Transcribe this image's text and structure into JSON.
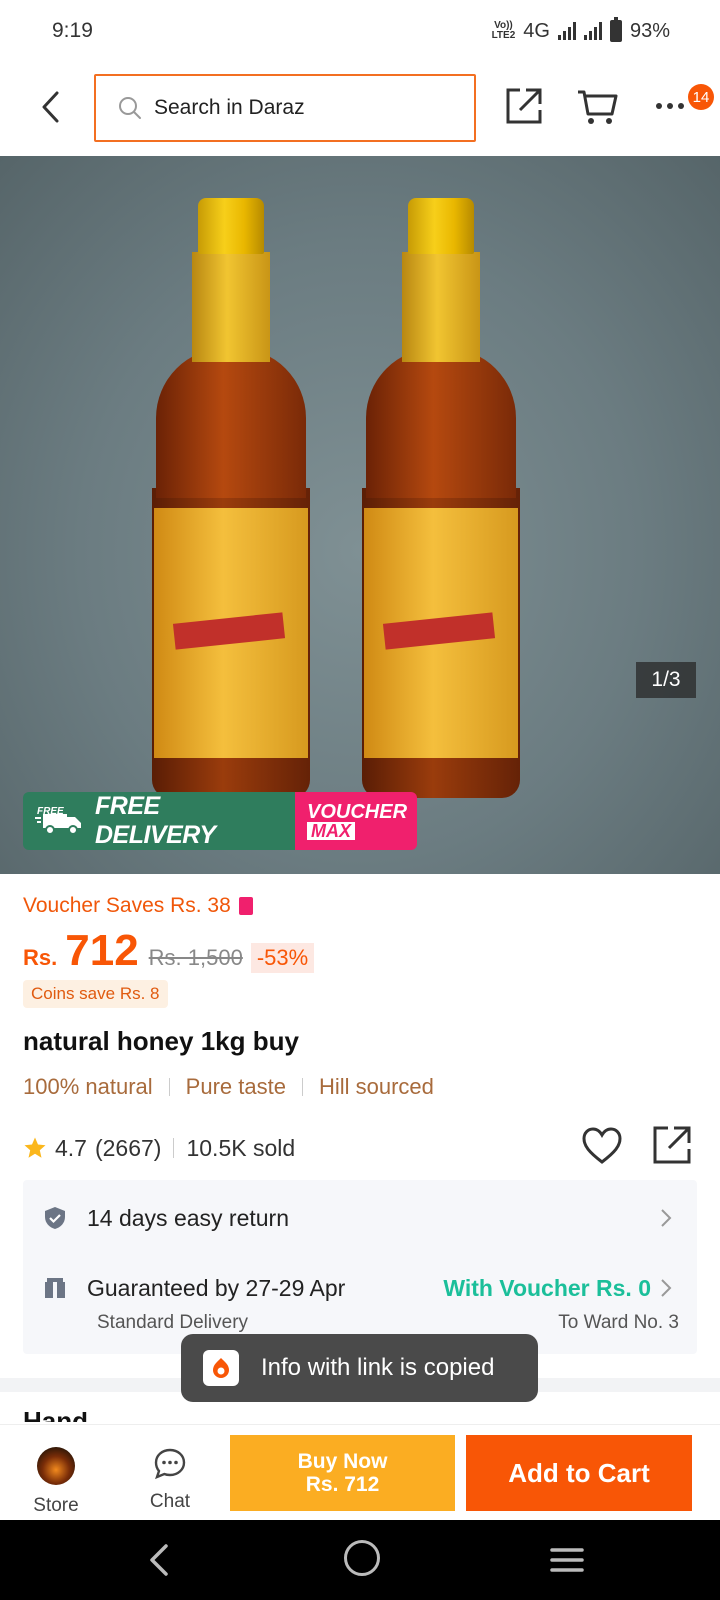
{
  "status_bar": {
    "time": "9:19",
    "volte_top": "Vo))",
    "volte_bottom": "LTE2",
    "network": "4G",
    "battery": "93%"
  },
  "header": {
    "search_placeholder": "Search in Daraz",
    "more_badge": "14"
  },
  "gallery": {
    "counter": "1/3",
    "promo_free_small": "FREE",
    "promo_free_delivery": "FREE DELIVERY",
    "promo_voucher": "VOUCHER",
    "promo_max": "MAX"
  },
  "price": {
    "voucher_saves": "Voucher Saves Rs. 38",
    "currency": "Rs.",
    "value": "712",
    "original": "Rs. 1,500",
    "discount": "-53%",
    "coins": "Coins save Rs. 8"
  },
  "product": {
    "title": "natural honey 1kg buy",
    "tags": [
      "100% natural",
      "Pure taste",
      "Hill sourced"
    ],
    "rating": "4.7",
    "reviews": "(2667)",
    "sold": "10.5K sold"
  },
  "service": {
    "return_text": "14 days easy return",
    "delivery_text": "Guaranteed by 27-29 Apr",
    "voucher_text": "With Voucher Rs. 0",
    "delivery_type": "Standard Delivery",
    "destination": "To Ward No. 3"
  },
  "toast": {
    "message": "Info with link is copied"
  },
  "bottom_bar": {
    "store_label": "Store",
    "chat_label": "Chat",
    "buy_now_line1": "Buy Now",
    "buy_now_line2": "Rs. 712",
    "add_to_cart": "Add to Cart"
  },
  "colors": {
    "accent": "#f85606",
    "buy_now": "#fbad22",
    "voucher_green": "#1bbf9a",
    "promo_green": "#2f7d5d",
    "promo_pink": "#f0206d"
  }
}
